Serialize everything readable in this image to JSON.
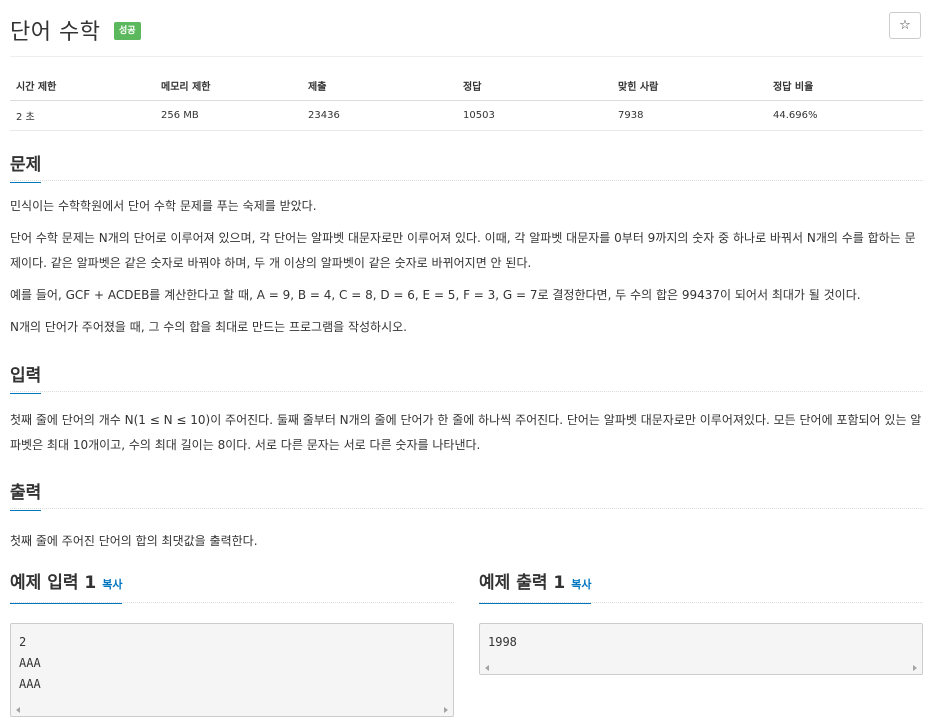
{
  "problem": {
    "title": "단어 수학",
    "badge": "성공",
    "star_icon": "☆"
  },
  "info": {
    "headers": [
      "시간 제한",
      "메모리 제한",
      "제출",
      "정답",
      "맞힌 사람",
      "정답 비율"
    ],
    "values": [
      "2 초",
      "256 MB",
      "23436",
      "10503",
      "7938",
      "44.696%"
    ]
  },
  "sections": {
    "problem": {
      "title": "문제",
      "paragraphs": [
        "민식이는 수학학원에서 단어 수학 문제를 푸는 숙제를 받았다.",
        "단어 수학 문제는 N개의 단어로 이루어져 있으며, 각 단어는 알파벳 대문자로만 이루어져 있다. 이때, 각 알파벳 대문자를 0부터 9까지의 숫자 중 하나로 바꿔서 N개의 수를 합하는 문제이다. 같은 알파벳은 같은 숫자로 바꿔야 하며, 두 개 이상의 알파벳이 같은 숫자로 바뀌어지면 안 된다.",
        "예를 들어, GCF + ACDEB를 계산한다고 할 때, A = 9, B = 4, C = 8, D = 6, E = 5, F = 3, G = 7로 결정한다면, 두 수의 합은 99437이 되어서 최대가 될 것이다.",
        "N개의 단어가 주어졌을 때, 그 수의 합을 최대로 만드는 프로그램을 작성하시오."
      ]
    },
    "input": {
      "title": "입력",
      "text": "첫째 줄에 단어의 개수 N(1 ≤ N ≤ 10)이 주어진다. 둘째 줄부터 N개의 줄에 단어가 한 줄에 하나씩 주어진다. 단어는 알파벳 대문자로만 이루어져있다. 모든 단어에 포함되어 있는 알파벳은 최대 10개이고, 수의 최대 길이는 8이다. 서로 다른 문자는 서로 다른 숫자를 나타낸다."
    },
    "output": {
      "title": "출력",
      "text": "첫째 줄에 주어진 단어의 합의 최댓값을 출력한다."
    }
  },
  "examples": {
    "input": {
      "title": "예제 입력 1",
      "copy_label": "복사",
      "content": "2\nAAA\nAAA"
    },
    "output": {
      "title": "예제 출력 1",
      "copy_label": "복사",
      "content": "1998"
    }
  }
}
